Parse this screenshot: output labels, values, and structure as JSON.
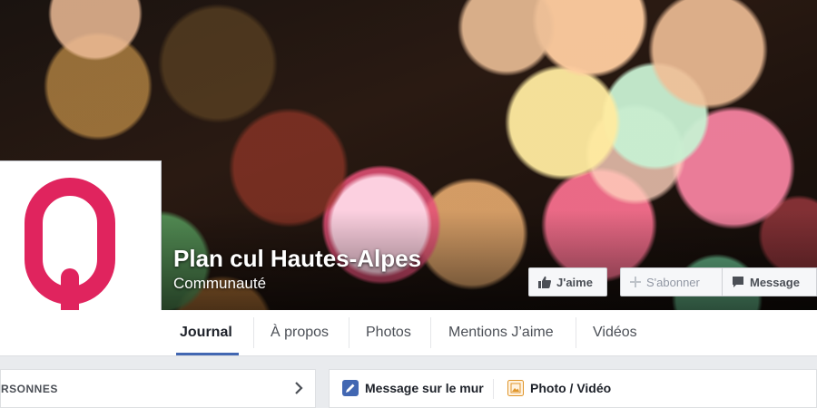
{
  "page": {
    "name": "Plan cul Hautes-Alpes",
    "category": "Communauté"
  },
  "actions": {
    "like_label": "J'aime",
    "subscribe_label": "S'abonner",
    "message_label": "Message"
  },
  "tabs": [
    {
      "label": "Journal",
      "active": true
    },
    {
      "label": "À propos",
      "active": false
    },
    {
      "label": "Photos",
      "active": false
    },
    {
      "label": "Mentions J’aime",
      "active": false
    },
    {
      "label": "Vidéos",
      "active": false
    }
  ],
  "left_panel": {
    "label": "RSONNES"
  },
  "composer": {
    "status_label": "Message sur le mur",
    "photo_label": "Photo / Vidéo"
  },
  "colors": {
    "accent": "#4267b2",
    "logo": "#e0245e"
  },
  "icons": {
    "like": "thumbs-up-icon",
    "subscribe": "plus-icon",
    "message": "speech-bubble-icon",
    "chevron": "chevron-right-icon",
    "status": "pencil-icon",
    "photo": "photo-icon"
  }
}
